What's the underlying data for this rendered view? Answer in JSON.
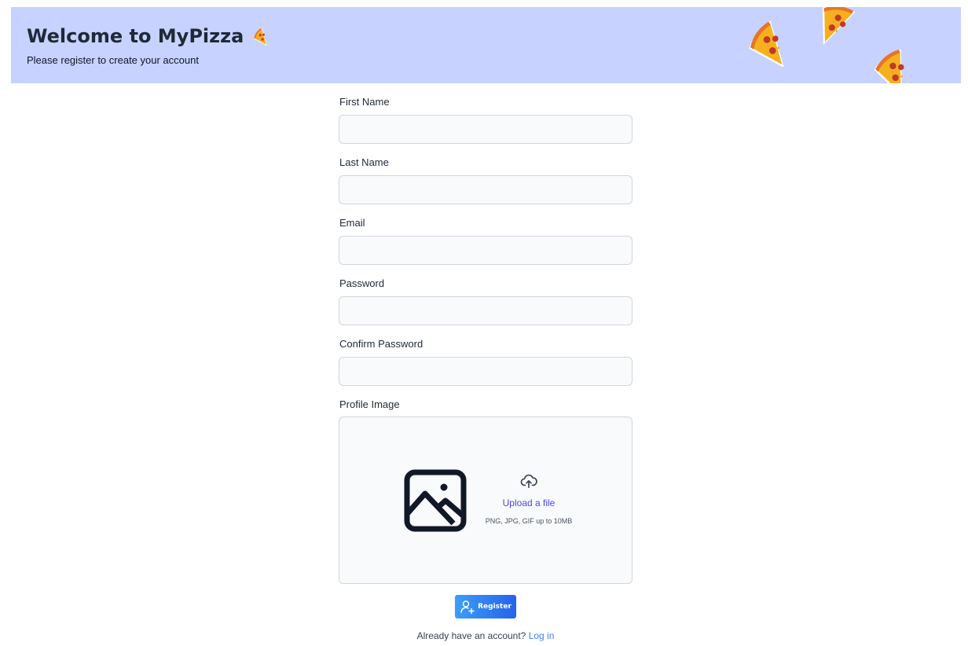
{
  "header": {
    "title": "Welcome to MyPizza",
    "subtitle": "Please register to create your account",
    "background_color": "#c7d2fe",
    "decorations": [
      "pizza-slice-icon",
      "pizza-slice-icon",
      "pizza-slice-icon"
    ]
  },
  "form": {
    "fields": [
      {
        "label": "First Name",
        "value": "",
        "type": "text"
      },
      {
        "label": "Last Name",
        "value": "",
        "type": "text"
      },
      {
        "label": "Email",
        "value": "",
        "type": "email"
      },
      {
        "label": "Password",
        "value": "",
        "type": "password"
      },
      {
        "label": "Confirm Password",
        "value": "",
        "type": "password"
      }
    ],
    "profile_image": {
      "label": "Profile Image",
      "preview_icon": "image-icon",
      "upload_icon": "cloud-upload-icon",
      "upload_link": "Upload a file",
      "hint": "PNG, JPG, GIF up to 10MB"
    },
    "submit": {
      "label": "Register",
      "icon": "user-plus-icon"
    },
    "footer": {
      "prompt": "Already have an account?",
      "link": "Log in"
    }
  },
  "colors": {
    "accent": "#4f46e5",
    "link": "#3b82f6",
    "button_start": "#3b9ef7",
    "button_end": "#2563eb"
  }
}
